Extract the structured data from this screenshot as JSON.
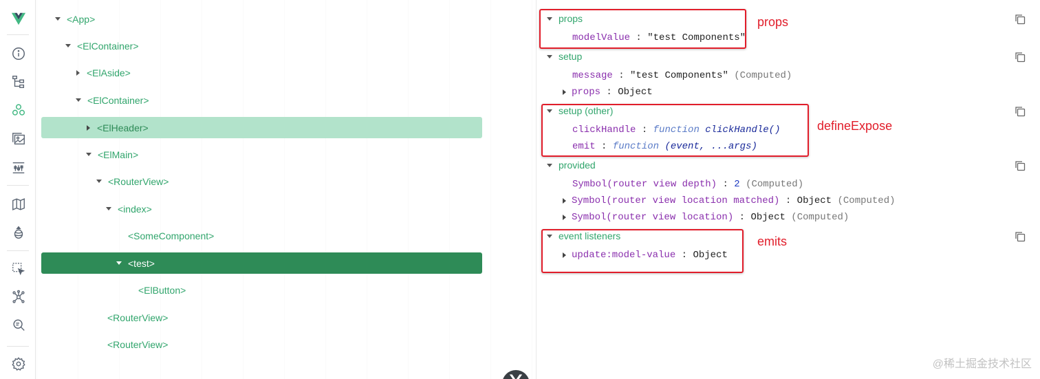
{
  "sidebar": {
    "icons": [
      "vue-logo-icon",
      "info-icon",
      "component-tree-icon",
      "components-icon",
      "assets-icon",
      "timeline-icon",
      "pinia-map-icon",
      "pinia-icon",
      "inspect-element-icon",
      "graph-icon",
      "search-icon",
      "settings-icon"
    ],
    "accent": "#42b883"
  },
  "tree": {
    "nodes": [
      {
        "label": "<App>"
      },
      {
        "label": "<ElContainer>"
      },
      {
        "label": "<ElAside>"
      },
      {
        "label": "<ElContainer>"
      },
      {
        "label": "<ElHeader>"
      },
      {
        "label": "<ElMain>"
      },
      {
        "label": "<RouterView>"
      },
      {
        "label": "<index>"
      },
      {
        "label": "<SomeComponent>"
      },
      {
        "label": "<test>"
      },
      {
        "label": "<ElButton>"
      },
      {
        "label": "<RouterView>"
      },
      {
        "label": "<RouterView>"
      }
    ],
    "selected_color": "#2e8b57",
    "hover_color": "#b2e3cb"
  },
  "inspector": {
    "props": {
      "title": "props",
      "items": [
        {
          "key": "modelValue",
          "value": "\"test Components\""
        }
      ]
    },
    "setup": {
      "title": "setup",
      "items": [
        {
          "key": "message",
          "value": "\"test Components\"",
          "note": "(Computed)"
        },
        {
          "key": "props",
          "value": "Object"
        }
      ]
    },
    "setup_other": {
      "title": "setup (other)",
      "items": [
        {
          "key": "clickHandle",
          "fn": "function",
          "value": "clickHandle()"
        },
        {
          "key": "emit",
          "fn": "function",
          "value": "(event, ...args)"
        }
      ]
    },
    "provided": {
      "title": "provided",
      "items": [
        {
          "key": "Symbol(router view depth)",
          "value": "2",
          "note": "(Computed)"
        },
        {
          "key": "Symbol(router view location matched)",
          "value": "Object",
          "note": "(Computed)"
        },
        {
          "key": "Symbol(router view location)",
          "value": "Object",
          "note": "(Computed)"
        }
      ]
    },
    "event_listeners": {
      "title": "event listeners",
      "items": [
        {
          "key": "update:model-value",
          "value": "Object"
        }
      ]
    },
    "separator": ":"
  },
  "annotations": {
    "props": "props",
    "define_expose": "defineExpose",
    "emits": "emits",
    "color": "#e11d2a"
  },
  "watermark": "@稀土掘金技术社区"
}
